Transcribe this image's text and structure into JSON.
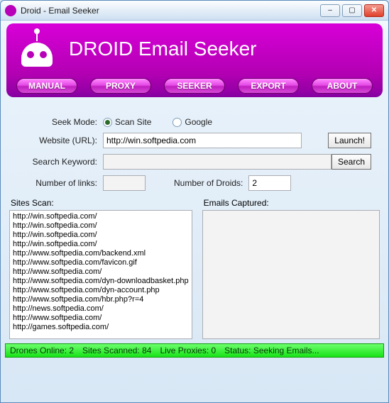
{
  "window_title": "Droid - Email Seeker",
  "banner_title": "DROID Email Seeker",
  "tabs": [
    "MANUAL",
    "PROXY",
    "SEEKER",
    "EXPORT",
    "ABOUT"
  ],
  "form": {
    "seek_mode_label": "Seek Mode:",
    "radio_scan": "Scan Site",
    "radio_google": "Google",
    "url_label": "Website (URL):",
    "url_value": "http://win.softpedia.com",
    "launch": "Launch!",
    "kw_label": "Search Keyword:",
    "kw_value": "",
    "search": "Search",
    "links_label": "Number of links:",
    "links_value": "",
    "droids_label": "Number of Droids:",
    "droids_value": "2"
  },
  "lists": {
    "scan_label": "Sites Scan:",
    "emails_label": "Emails Captured:",
    "sites": [
      "http://win.softpedia.com/",
      "http://win.softpedia.com/",
      "http://win.softpedia.com/",
      "http://win.softpedia.com/",
      "http://www.softpedia.com/backend.xml",
      "http://www.softpedia.com/favicon.gif",
      "http://www.softpedia.com/",
      "http://www.softpedia.com/dyn-downloadbasket.php",
      "http://www.softpedia.com/dyn-account.php",
      "http://www.softpedia.com/hbr.php?r=4",
      "http://news.softpedia.com/",
      "http://www.softpedia.com/",
      "http://games.softpedia.com/"
    ]
  },
  "status": {
    "drones": "Drones Online: 2",
    "scanned": "Sites Scanned: 84",
    "proxies": "Live Proxies: 0",
    "state": "Status: Seeking Emails..."
  }
}
